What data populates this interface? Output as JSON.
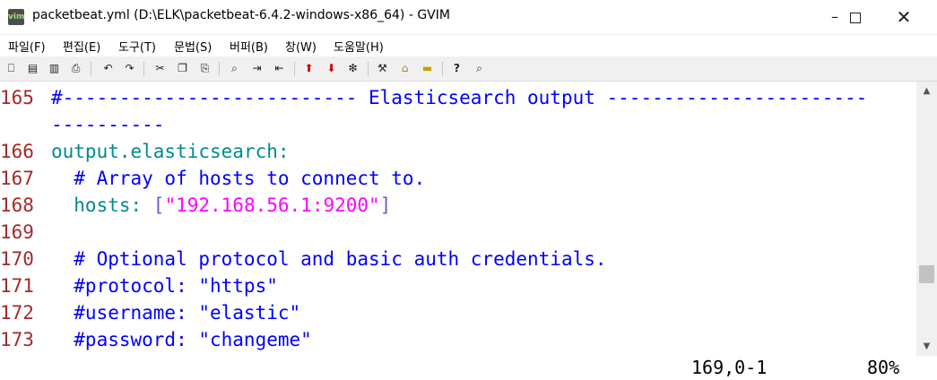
{
  "window": {
    "title": "packetbeat.yml (D:\\ELK\\packetbeat-6.4.2-windows-x86_64) - GVIM",
    "app_icon_text": "vim",
    "minimize_icon": "minimize-icon",
    "maximize_icon": "maximize-icon",
    "close_icon": "close-icon"
  },
  "menubar": [
    {
      "label": "파일(F)"
    },
    {
      "label": "편집(E)"
    },
    {
      "label": "도구(T)"
    },
    {
      "label": "문법(S)"
    },
    {
      "label": "버퍼(B)"
    },
    {
      "label": "창(W)"
    },
    {
      "label": "도움말(H)"
    }
  ],
  "toolbar": {
    "icons": [
      "open-icon",
      "save-icon",
      "save-all-icon",
      "print-icon",
      "undo-icon",
      "redo-icon",
      "cut-icon",
      "copy-icon",
      "paste-icon",
      "find-replace-icon",
      "find-next-icon",
      "find-prev-icon",
      "load-session-icon",
      "save-session-icon",
      "run-script-icon",
      "make-icon",
      "build-tags-icon",
      "jump-tag-icon",
      "help-icon",
      "find-help-icon"
    ]
  },
  "editor": {
    "lines": [
      {
        "num": "165",
        "parts": [
          {
            "t": "#-------------------------- Elasticsearch output -----------------------",
            "c": "cm"
          }
        ]
      },
      {
        "num": "",
        "parts": [
          {
            "t": "----------",
            "c": "cm"
          }
        ]
      },
      {
        "num": "166",
        "parts": [
          {
            "t": "output.elasticsearch:",
            "c": "key"
          }
        ]
      },
      {
        "num": "167",
        "parts": [
          {
            "t": "  # Array of hosts to connect to.",
            "c": "cm"
          }
        ]
      },
      {
        "num": "168",
        "parts": [
          {
            "t": "  hosts: ",
            "c": "key"
          },
          {
            "t": "[",
            "c": "brk"
          },
          {
            "t": "\"192.168.56.1:9200\"",
            "c": "str"
          },
          {
            "t": "]",
            "c": "brk"
          }
        ]
      },
      {
        "num": "169",
        "parts": []
      },
      {
        "num": "170",
        "parts": [
          {
            "t": "  # Optional protocol and basic auth credentials.",
            "c": "cm"
          }
        ]
      },
      {
        "num": "171",
        "parts": [
          {
            "t": "  #protocol: \"https\"",
            "c": "cm"
          }
        ]
      },
      {
        "num": "172",
        "parts": [
          {
            "t": "  #username: \"elastic\"",
            "c": "cm"
          }
        ]
      },
      {
        "num": "173",
        "parts": [
          {
            "t": "  #password: \"changeme\"",
            "c": "cm"
          }
        ]
      }
    ]
  },
  "status": {
    "position": "169,0-1",
    "percent": "80%"
  }
}
